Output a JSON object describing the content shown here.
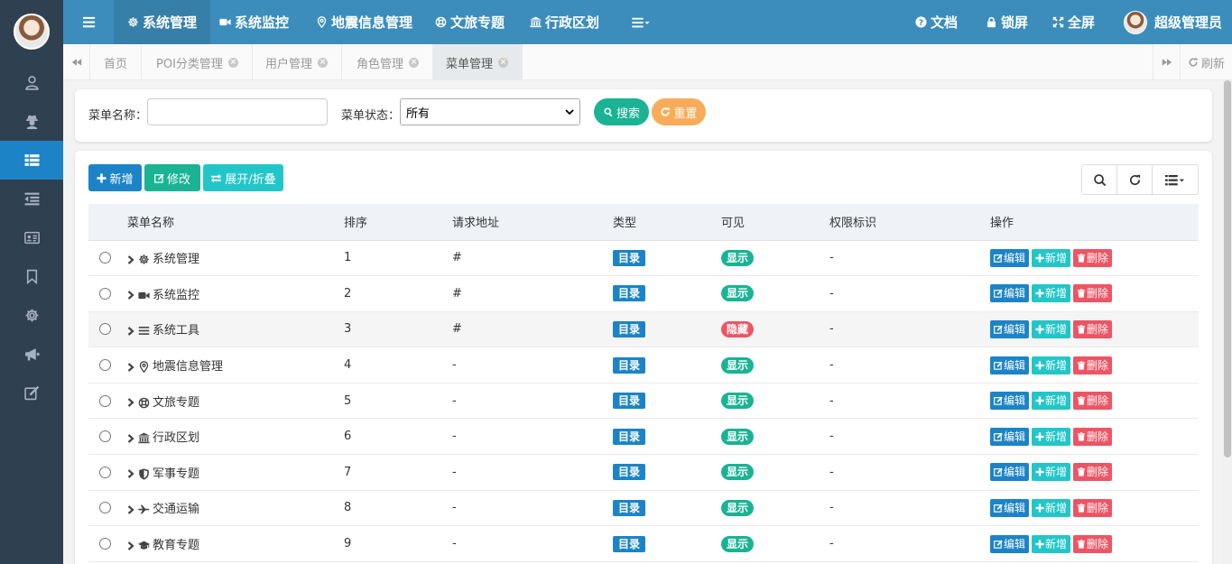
{
  "colors": {
    "sidebar_bg": "#2f4050",
    "topbar_bg": "#3c8dbc",
    "primary": "#1c84c6",
    "success": "#1ab394",
    "info": "#23c6c8",
    "warning": "#f8ac59",
    "danger": "#ed5565"
  },
  "sidebar": {
    "items": [
      {
        "icon": "user-icon"
      },
      {
        "icon": "user-secret-icon"
      },
      {
        "icon": "table-icon",
        "active": true
      },
      {
        "icon": "outdent-icon"
      },
      {
        "icon": "id-card-icon"
      },
      {
        "icon": "bookmark-icon"
      },
      {
        "icon": "gear-icon"
      },
      {
        "icon": "bullhorn-icon"
      },
      {
        "icon": "edit-icon"
      }
    ]
  },
  "topbar": {
    "menu_toggle_icon": "bars-icon",
    "nav": [
      {
        "label": "系统管理",
        "icon": "gear-icon",
        "active": true
      },
      {
        "label": "系统监控",
        "icon": "video-camera-icon"
      },
      {
        "label": "地震信息管理",
        "icon": "map-marker-icon"
      },
      {
        "label": "文旅专题",
        "icon": "life-ring-icon"
      },
      {
        "label": "行政区划",
        "icon": "bank-icon"
      }
    ],
    "more_icon": "list-dropdown-icon",
    "docs_label": "文档",
    "lock_label": "锁屏",
    "fullscreen_label": "全屏",
    "user_name": "超级管理员"
  },
  "tabs": {
    "items": [
      {
        "label": "首页",
        "closable": false
      },
      {
        "label": "POI分类管理",
        "closable": true
      },
      {
        "label": "用户管理",
        "closable": true
      },
      {
        "label": "角色管理",
        "closable": true
      },
      {
        "label": "菜单管理",
        "closable": true,
        "active": true
      }
    ],
    "close_glyph": "×",
    "refresh_label": "刷新"
  },
  "search": {
    "name_label": "菜单名称：",
    "name_value": "",
    "status_label": "菜单状态：",
    "status_value": "所有",
    "search_label": "搜索",
    "reset_label": "重置"
  },
  "toolbar": {
    "add_label": "新增",
    "edit_label": "修改",
    "expand_label": "展开/折叠"
  },
  "table": {
    "headers": [
      "菜单名称",
      "排序",
      "请求地址",
      "类型",
      "可见",
      "权限标识",
      "操作"
    ],
    "rows": [
      {
        "name": "系统管理",
        "icon": "gear-icon",
        "order": "1",
        "url": "#",
        "type": "目录",
        "visible": "显示",
        "perm": "-"
      },
      {
        "name": "系统监控",
        "icon": "video-camera-icon",
        "order": "2",
        "url": "#",
        "type": "目录",
        "visible": "显示",
        "perm": "-"
      },
      {
        "name": "系统工具",
        "icon": "bars-icon",
        "order": "3",
        "url": "#",
        "type": "目录",
        "visible": "隐藏",
        "perm": "-",
        "highlight": true
      },
      {
        "name": "地震信息管理",
        "icon": "map-marker-icon",
        "order": "4",
        "url": "-",
        "type": "目录",
        "visible": "显示",
        "perm": "-"
      },
      {
        "name": "文旅专题",
        "icon": "life-ring-icon",
        "order": "5",
        "url": "-",
        "type": "目录",
        "visible": "显示",
        "perm": "-"
      },
      {
        "name": "行政区划",
        "icon": "bank-icon",
        "order": "6",
        "url": "-",
        "type": "目录",
        "visible": "显示",
        "perm": "-"
      },
      {
        "name": "军事专题",
        "icon": "shield-icon",
        "order": "7",
        "url": "-",
        "type": "目录",
        "visible": "显示",
        "perm": "-"
      },
      {
        "name": "交通运输",
        "icon": "plane-icon",
        "order": "8",
        "url": "-",
        "type": "目录",
        "visible": "显示",
        "perm": "-"
      },
      {
        "name": "教育专题",
        "icon": "graduation-cap-icon",
        "order": "9",
        "url": "-",
        "type": "目录",
        "visible": "显示",
        "perm": "-"
      }
    ],
    "op_edit": "编辑",
    "op_add": "新增",
    "op_delete": "删除"
  }
}
